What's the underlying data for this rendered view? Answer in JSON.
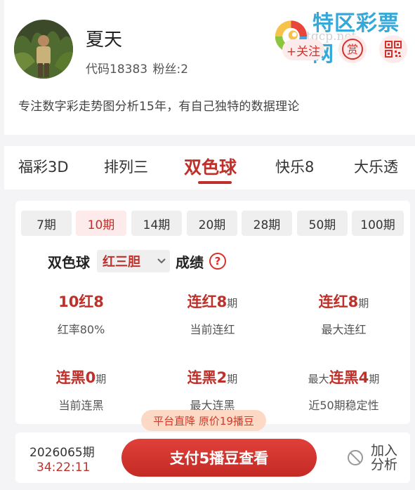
{
  "user": {
    "name": "夏天",
    "code": "代码18383",
    "fans": "粉丝:2",
    "bio": "专注数字彩走势图分析15年，有自己独特的数据理论"
  },
  "brand": {
    "name": "特区彩票网",
    "watermark": "tqcp.net"
  },
  "actions": {
    "follow": "+关注",
    "reward": "赏"
  },
  "tabs": [
    "福彩3D",
    "排列三",
    "双色球",
    "快乐8",
    "大乐透"
  ],
  "active_tab": 2,
  "periods": [
    "7期",
    "10期",
    "14期",
    "20期",
    "28期",
    "50期",
    "100期"
  ],
  "active_period": 1,
  "section": {
    "label": "双色球",
    "select_value": "红三胆",
    "suffix": "成绩",
    "help": "?"
  },
  "stats": [
    {
      "main": "10红8",
      "label": "红率80%"
    },
    {
      "main": "连红8",
      "unit": "期",
      "label": "当前连红"
    },
    {
      "main": "连红8",
      "unit": "期",
      "label": "最大连红"
    },
    {
      "main": "连黑0",
      "unit": "期",
      "label": "当前连黑"
    },
    {
      "main": "连黑2",
      "unit": "期",
      "label": "最大连黑"
    },
    {
      "prefix": "最大",
      "main": "连黑4",
      "unit": "期",
      "label": "近50期稳定性"
    }
  ],
  "bottom": {
    "issue": "2026065期",
    "countdown": "34:22:11",
    "price_tip": "平台直降 原价19播豆",
    "pay": "支付5播豆查看",
    "join": "加入分析"
  },
  "colors": {
    "accent": "#c0302a",
    "brand_blue": "#33a8d9",
    "tint": "#fdeaea"
  }
}
